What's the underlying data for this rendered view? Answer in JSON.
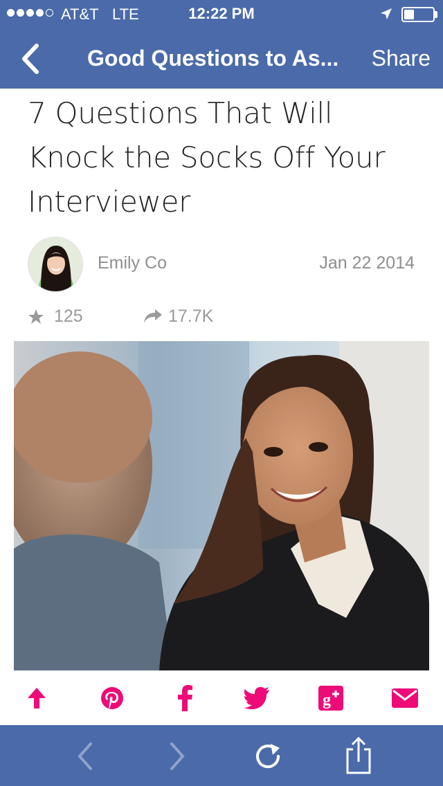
{
  "status_bar": {
    "carrier": "AT&T",
    "network": "LTE",
    "time": "12:22 PM",
    "signal_bars_filled": 4,
    "signal_bars_total": 5,
    "battery_level": 0.35
  },
  "nav": {
    "title": "Good Questions to As...",
    "share_label": "Share",
    "back_icon": "chevron-left-icon"
  },
  "article": {
    "title_lines": [
      "7 Questions That Will",
      "Knock the Socks Off Your",
      "Interviewer"
    ],
    "author": "Emily Co",
    "date": "Jan 22 2014",
    "stars": "125",
    "shares": "17.7K"
  },
  "share_bar": {
    "accent_color": "#ee0b78",
    "icons": [
      "upvote-arrow-icon",
      "pinterest-icon",
      "facebook-icon",
      "twitter-icon",
      "google-plus-icon",
      "email-icon"
    ]
  },
  "toolbar": {
    "icons": [
      "back-icon",
      "forward-icon",
      "refresh-icon",
      "share-icon"
    ]
  },
  "colors": {
    "brand_bar": "#4a6aaa",
    "text_gray": "#8f8f8f"
  }
}
